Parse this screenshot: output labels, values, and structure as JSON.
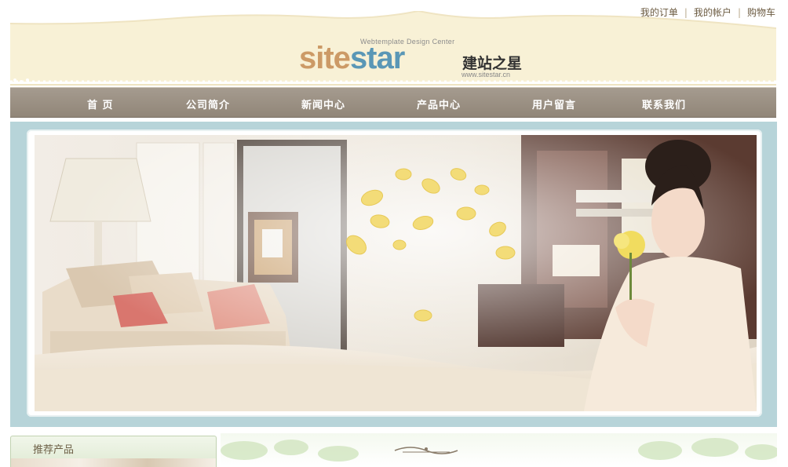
{
  "top_links": {
    "orders": "我的订单",
    "account": "我的帐户",
    "cart": "购物车",
    "separator": "|"
  },
  "logo": {
    "tagline": "Webtemplate  Design  Center",
    "word_part1": "site",
    "word_part2": "star",
    "chinese": "建站之星",
    "url": "www.sitestar.cn"
  },
  "nav": {
    "items": [
      "首 页",
      "公司简介",
      "新闻中心",
      "产品中心",
      "用户留言",
      "联系我们"
    ]
  },
  "sidebar": {
    "recommended_title": "推荐产品"
  },
  "colors": {
    "header_bg": "#f8f1d6",
    "nav_bg": "#9d9385",
    "hero_border": "#b7d4d9",
    "logo_site": "#cc9a66",
    "logo_star": "#5a97b6"
  }
}
